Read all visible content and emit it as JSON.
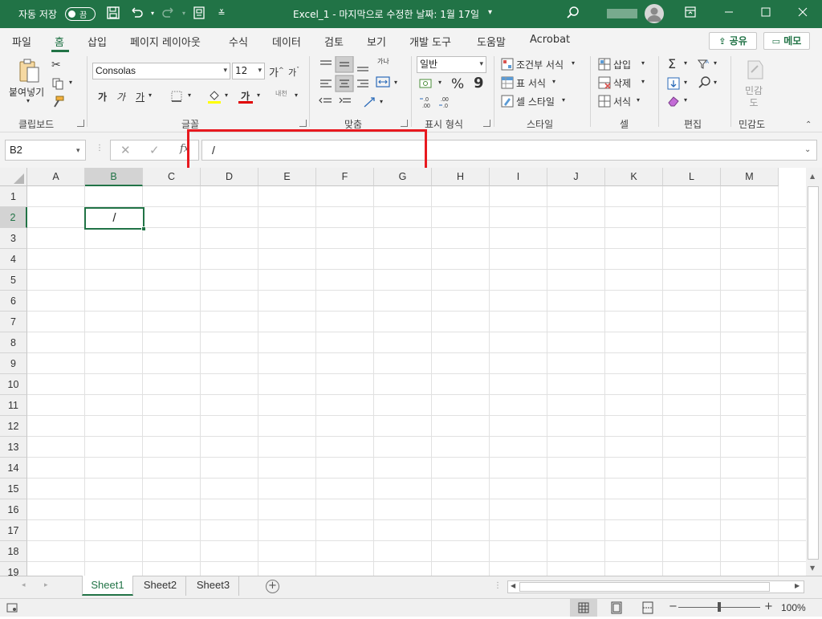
{
  "titlebar": {
    "autosave_label": "자동 저장",
    "autosave_state": "끔",
    "doc_title": "Excel_1 - 마지막으로 수정한 날짜: 1월 17일",
    "title_caret": "▾",
    "colors": {
      "bar": "#217346"
    }
  },
  "menu": {
    "tabs": [
      "파일",
      "홈",
      "삽입",
      "페이지 레이아웃",
      "수식",
      "데이터",
      "검토",
      "보기",
      "개발 도구",
      "도움말",
      "Acrobat"
    ],
    "active_tab": "홈",
    "share_label": "공유",
    "memo_label": "메모"
  },
  "ribbon": {
    "clipboard": {
      "paste_label": "붙여넣기",
      "group_label": "클립보드"
    },
    "font": {
      "font_name": "Consolas",
      "font_size": "12",
      "bold": "가",
      "italic": "가",
      "underline": "가",
      "font_color_glyph": "가",
      "phonetic": "내천",
      "grow": "가",
      "shrink": "가",
      "group_label": "글꼴"
    },
    "alignment": {
      "wrap_glyph": "가나",
      "group_label": "맞춤"
    },
    "number": {
      "format": "일반",
      "percent": "%",
      "comma": "9",
      "group_label": "표시 형식"
    },
    "styles": {
      "conditional": "조건부 서식",
      "table": "표 서식",
      "cell_style": "셀 스타일",
      "group_label": "스타일"
    },
    "cells": {
      "insert": "삽입",
      "delete": "삭제",
      "format": "서식",
      "group_label": "셀"
    },
    "editing": {
      "sum": "Σ",
      "group_label": "편집"
    },
    "sensitivity": {
      "label": "민감도",
      "group_label": "민감도"
    }
  },
  "formula_bar": {
    "name_box": "B2",
    "fx": "fx",
    "value": "/"
  },
  "grid": {
    "columns": [
      "A",
      "B",
      "C",
      "D",
      "E",
      "F",
      "G",
      "H",
      "I",
      "J",
      "K",
      "L",
      "M"
    ],
    "rows": [
      "1",
      "2",
      "3",
      "4",
      "5",
      "6",
      "7",
      "8",
      "9",
      "10",
      "11",
      "12",
      "13",
      "14",
      "15",
      "16",
      "17",
      "18",
      "19"
    ],
    "selected_column": "B",
    "selected_row": "2",
    "active_cell_value": "/"
  },
  "sheets": {
    "tabs": [
      "Sheet1",
      "Sheet2",
      "Sheet3"
    ],
    "active": "Sheet1"
  },
  "status": {
    "zoom": "100%",
    "zoom_minus": "−",
    "zoom_plus": "+"
  }
}
